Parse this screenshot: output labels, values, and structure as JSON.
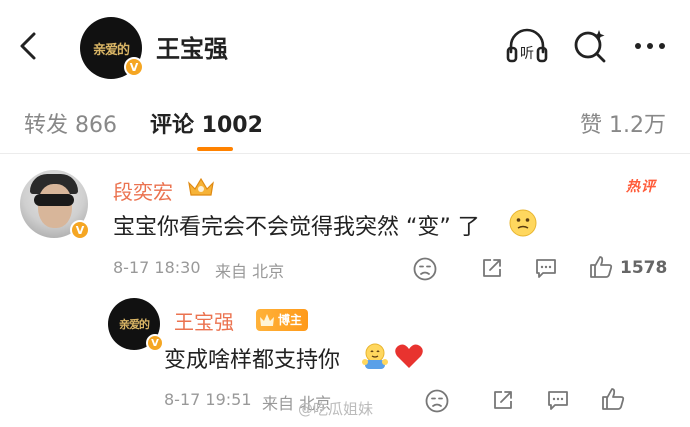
{
  "header": {
    "account_name": "王宝强",
    "avatar_text": "亲爱的"
  },
  "tabs": [
    {
      "label": "转发 866"
    },
    {
      "label": "评论 1002"
    },
    {
      "label": "赞 1.2万"
    }
  ],
  "comment": {
    "author": "段奕宏",
    "hot_label": "热评",
    "text": "宝宝你看完会不会觉得我突然 “变” 了",
    "time": "8-17 18:30",
    "location": "来自 北京",
    "likes": "1578",
    "reply": {
      "author": "王宝强",
      "tag": "博主",
      "avatar_text": "亲爱的",
      "text": "变成啥样都支持你",
      "time": "8-17 19:51",
      "location": "来自 北京"
    }
  },
  "watermark": "@吃瓜姐妹",
  "colors": {
    "accent": "#ff8200",
    "name": "#eb7350",
    "hot": "#ff5c3a",
    "verified": "#f5a623"
  },
  "icons": [
    "back-arrow",
    "listen-headphone",
    "search",
    "more-dots",
    "crown",
    "hot",
    "dislike",
    "share",
    "comment",
    "like",
    "heart"
  ]
}
